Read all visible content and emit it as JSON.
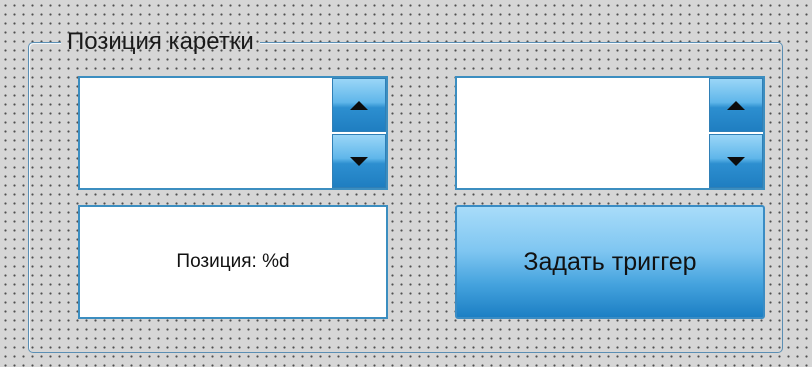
{
  "group": {
    "title": "Позиция каретки"
  },
  "spin_left": {
    "value": "",
    "up_icon": "arrow-up-icon",
    "down_icon": "arrow-down-icon"
  },
  "spin_right": {
    "value": "",
    "up_icon": "arrow-up-icon",
    "down_icon": "arrow-down-icon"
  },
  "position_label": {
    "text": "Позиция: %d"
  },
  "trigger_button": {
    "label": "Задать триггер"
  },
  "colors": {
    "accent": "#2d8fd0",
    "border": "#3c8ec0",
    "background": "#d6d6d6"
  }
}
